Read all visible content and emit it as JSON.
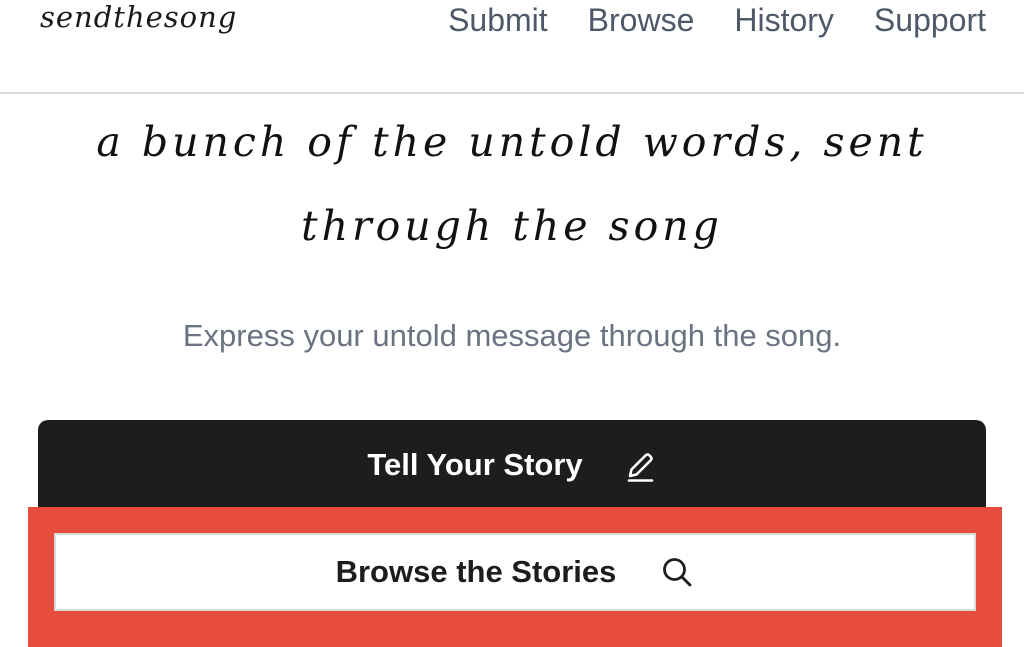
{
  "header": {
    "logo": "sendthesong",
    "nav": [
      "Submit",
      "Browse",
      "History",
      "Support"
    ]
  },
  "hero": {
    "tagline_line1": "a bunch of the untold words, sent",
    "tagline_line2": "through the song",
    "subtitle": "Express your untold message through the song."
  },
  "actions": {
    "primary_label": "Tell Your Story",
    "primary_icon": "pencil-icon",
    "secondary_label": "Browse the Stories",
    "secondary_icon": "search-icon"
  },
  "colors": {
    "primary_button_bg": "#1d1d1d",
    "highlight_box": "#e74d3c",
    "nav_text": "#4f5868",
    "subtitle_text": "#6b7383"
  }
}
